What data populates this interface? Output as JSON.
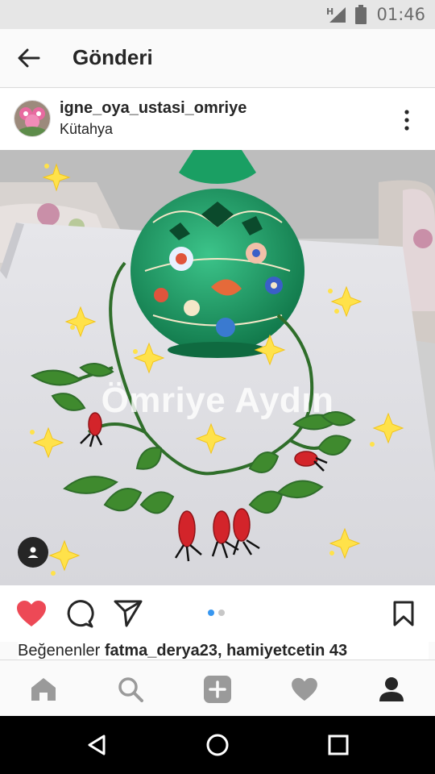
{
  "status_bar": {
    "network_label": "H",
    "time": "01:46",
    "icons": [
      "network-h-icon",
      "signal-icon",
      "battery-icon"
    ]
  },
  "header": {
    "title": "Gönderi",
    "back_icon": "back-arrow-icon"
  },
  "post": {
    "username": "igne_oya_ustasi_omriye",
    "location": "Kütahya",
    "more_icon": "more-vertical-icon",
    "image": {
      "watermark": "Ömriye Aydın",
      "description_icon": "user-tag-icon"
    },
    "actions": {
      "like_icon": "heart-filled-icon",
      "comment_icon": "comment-icon",
      "share_icon": "send-icon",
      "save_icon": "bookmark-icon",
      "carousel_pages": 2,
      "carousel_current": 1
    },
    "likes": {
      "prefix": "Beğenenler",
      "names": "fatma_derya23, hamiyetcetin",
      "more": "43"
    }
  },
  "tab_bar": {
    "items": [
      "home-icon",
      "search-icon",
      "add-icon",
      "activity-heart-icon",
      "profile-icon"
    ],
    "active": "profile-icon"
  },
  "nav_bar": {
    "items": [
      "back-triangle-icon",
      "home-circle-icon",
      "recents-square-icon"
    ]
  },
  "colors": {
    "like_red": "#ed4956",
    "carousel_blue": "#3897f0",
    "text": "#262626"
  }
}
